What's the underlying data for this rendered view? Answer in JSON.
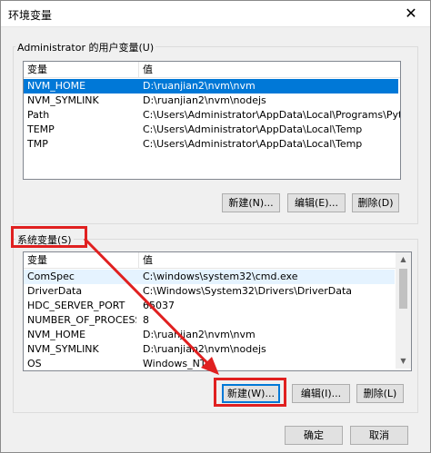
{
  "window": {
    "title": "环境变量",
    "close_glyph": "✕"
  },
  "user_vars": {
    "group_label": "Administrator 的用户变量(U)",
    "col_name": "变量",
    "col_value": "值",
    "rows": [
      {
        "name": "NVM_HOME",
        "value": "D:\\ruanjian2\\nvm\\nvm"
      },
      {
        "name": "NVM_SYMLINK",
        "value": "D:\\ruanjian2\\nvm\\nodejs"
      },
      {
        "name": "Path",
        "value": "C:\\Users\\Administrator\\AppData\\Local\\Programs\\Python\\Pyt..."
      },
      {
        "name": "TEMP",
        "value": "C:\\Users\\Administrator\\AppData\\Local\\Temp"
      },
      {
        "name": "TMP",
        "value": "C:\\Users\\Administrator\\AppData\\Local\\Temp"
      }
    ],
    "buttons": {
      "new": "新建(N)...",
      "edit": "编辑(E)...",
      "delete": "删除(D)"
    }
  },
  "system_vars": {
    "group_label": "系统变量(S)",
    "col_name": "变量",
    "col_value": "值",
    "rows": [
      {
        "name": "ComSpec",
        "value": "C:\\windows\\system32\\cmd.exe"
      },
      {
        "name": "DriverData",
        "value": "C:\\Windows\\System32\\Drivers\\DriverData"
      },
      {
        "name": "HDC_SERVER_PORT",
        "value": "65037"
      },
      {
        "name": "NUMBER_OF_PROCESSORS",
        "value": "8"
      },
      {
        "name": "NVM_HOME",
        "value": "D:\\ruanjian2\\nvm\\nvm"
      },
      {
        "name": "NVM_SYMLINK",
        "value": "D:\\ruanjian2\\nvm\\nodejs"
      },
      {
        "name": "OS",
        "value": "Windows_NT"
      }
    ],
    "buttons": {
      "new": "新建(W)...",
      "edit": "编辑(I)...",
      "delete": "删除(L)"
    }
  },
  "footer": {
    "ok": "确定",
    "cancel": "取消"
  },
  "colors": {
    "annotation_red": "#e02020",
    "selection_blue": "#0078d7"
  }
}
